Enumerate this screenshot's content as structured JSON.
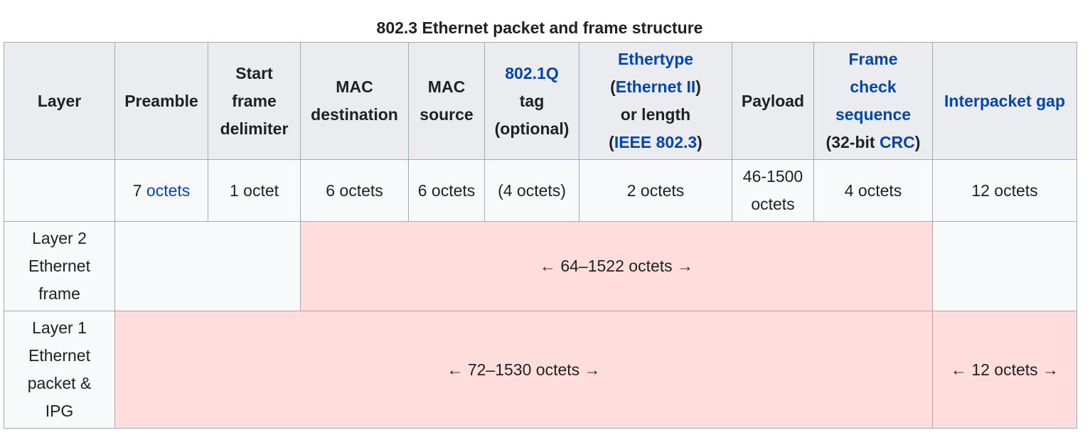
{
  "caption": "802.3 Ethernet packet and frame structure",
  "colors": {
    "header_bg": "#eaecf0",
    "cell_bg": "#f8f9fa",
    "highlight_bg": "#ffdddd",
    "link": "#0645ad",
    "border": "#a2a9b1"
  },
  "header": {
    "layer": "Layer",
    "preamble": "Preamble",
    "sfd": [
      "Start",
      "frame",
      "delimiter"
    ],
    "mac_dest": [
      "MAC",
      "destination"
    ],
    "mac_src": [
      "MAC",
      "source"
    ],
    "tag": {
      "link": "802.1Q",
      "rest": [
        "tag",
        "(optional)"
      ]
    },
    "ethertype": {
      "link1": "Ethertype",
      "open": "(",
      "link2": "Ethernet II",
      "close": ")",
      "mid": "or length",
      "open2": "(",
      "link3": "IEEE 802.3",
      "close2": ")"
    },
    "payload": "Payload",
    "fcs": {
      "link": [
        "Frame",
        "check",
        "sequence"
      ],
      "pre": "(32-bit ",
      "link2": "CRC",
      "post": ")"
    },
    "ipg": "Interpacket gap"
  },
  "sizes": {
    "layer": "",
    "preamble_num": "7 ",
    "preamble_link": "octets",
    "sfd": "1 octet",
    "mac_dest": "6 octets",
    "mac_src": "6 octets",
    "tag": "(4 octets)",
    "ethertype": "2 octets",
    "payload": [
      "46-1500",
      "octets"
    ],
    "fcs": "4 octets",
    "ipg": "12 octets"
  },
  "layer2": {
    "label": [
      "Layer 2",
      "Ethernet",
      "frame"
    ],
    "span": "← 64–1522 octets →"
  },
  "layer1": {
    "label": [
      "Layer 1",
      "Ethernet",
      "packet &",
      "IPG"
    ],
    "span": "← 72–1530 octets →",
    "ipg": "← 12 octets →"
  }
}
